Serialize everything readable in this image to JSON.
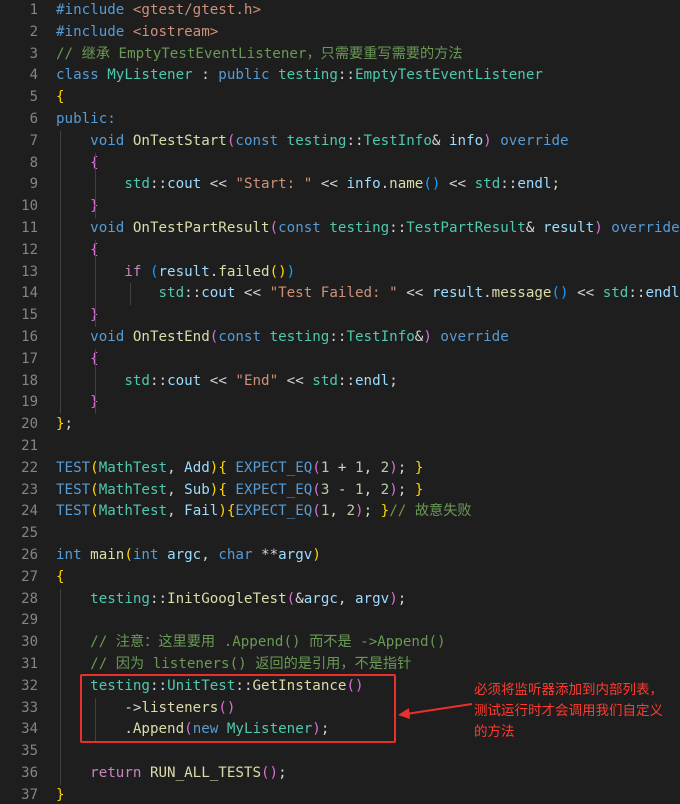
{
  "editor": {
    "theme_colors": {
      "background": "#1e1e1e",
      "line_number": "#858585",
      "keyword": "#569cd6",
      "control": "#c586c0",
      "type": "#4ec9b0",
      "function": "#dcdcaa",
      "string": "#ce9178",
      "comment": "#6a9955",
      "variable": "#9cdcfe",
      "number": "#b5cea8",
      "default": "#d4d4d4",
      "bracket": "#ffd700",
      "bracket2": "#da70d6",
      "bracket3": "#179fff",
      "annotation": "#ff3b30"
    },
    "lines": [
      {
        "n": "1",
        "tokens": [
          [
            "#include ",
            "keyword"
          ],
          [
            "<gtest/gtest.h>",
            "string"
          ]
        ]
      },
      {
        "n": "2",
        "tokens": [
          [
            "#include ",
            "keyword"
          ],
          [
            "<iostream>",
            "string"
          ]
        ]
      },
      {
        "n": "3",
        "tokens": [
          [
            "// 继承 EmptyTestEventListener，只需要重写需要的方法",
            "comment"
          ]
        ]
      },
      {
        "n": "4",
        "tokens": [
          [
            "class ",
            "keyword"
          ],
          [
            "MyListener",
            "type"
          ],
          [
            " : ",
            "default"
          ],
          [
            "public ",
            "keyword"
          ],
          [
            "testing",
            "type"
          ],
          [
            "::",
            "default"
          ],
          [
            "EmptyTestEventListener",
            "type"
          ]
        ]
      },
      {
        "n": "5",
        "tokens": [
          [
            "{",
            "bracket"
          ]
        ]
      },
      {
        "n": "6",
        "tokens": [
          [
            "public:",
            "keyword"
          ]
        ]
      },
      {
        "n": "7",
        "tokens": [
          [
            "    ",
            "default"
          ],
          [
            "void ",
            "keyword"
          ],
          [
            "OnTestStart",
            "function"
          ],
          [
            "(",
            "bracket2"
          ],
          [
            "const ",
            "keyword"
          ],
          [
            "testing",
            "type"
          ],
          [
            "::",
            "default"
          ],
          [
            "TestInfo",
            "type"
          ],
          [
            "& ",
            "default"
          ],
          [
            "info",
            "variable"
          ],
          [
            ")",
            "bracket2"
          ],
          [
            " override",
            "keyword"
          ]
        ]
      },
      {
        "n": "8",
        "tokens": [
          [
            "    ",
            "default"
          ],
          [
            "{",
            "bracket2"
          ]
        ]
      },
      {
        "n": "9",
        "tokens": [
          [
            "        ",
            "default"
          ],
          [
            "std",
            "type"
          ],
          [
            "::",
            "default"
          ],
          [
            "cout",
            "variable"
          ],
          [
            " << ",
            "default"
          ],
          [
            "\"Start: \"",
            "string"
          ],
          [
            " << ",
            "default"
          ],
          [
            "info",
            "variable"
          ],
          [
            ".",
            "default"
          ],
          [
            "name",
            "function"
          ],
          [
            "()",
            "bracket3"
          ],
          [
            " << ",
            "default"
          ],
          [
            "std",
            "type"
          ],
          [
            "::",
            "default"
          ],
          [
            "endl",
            "variable"
          ],
          [
            ";",
            "default"
          ]
        ]
      },
      {
        "n": "10",
        "tokens": [
          [
            "    ",
            "default"
          ],
          [
            "}",
            "bracket2"
          ]
        ]
      },
      {
        "n": "11",
        "tokens": [
          [
            "    ",
            "default"
          ],
          [
            "void ",
            "keyword"
          ],
          [
            "OnTestPartResult",
            "function"
          ],
          [
            "(",
            "bracket2"
          ],
          [
            "const ",
            "keyword"
          ],
          [
            "testing",
            "type"
          ],
          [
            "::",
            "default"
          ],
          [
            "TestPartResult",
            "type"
          ],
          [
            "& ",
            "default"
          ],
          [
            "result",
            "variable"
          ],
          [
            ")",
            "bracket2"
          ],
          [
            " override",
            "keyword"
          ]
        ]
      },
      {
        "n": "12",
        "tokens": [
          [
            "    ",
            "default"
          ],
          [
            "{",
            "bracket2"
          ]
        ]
      },
      {
        "n": "13",
        "tokens": [
          [
            "        ",
            "default"
          ],
          [
            "if ",
            "control"
          ],
          [
            "(",
            "bracket3"
          ],
          [
            "result",
            "variable"
          ],
          [
            ".",
            "default"
          ],
          [
            "failed",
            "function"
          ],
          [
            "()",
            "bracket"
          ],
          [
            ")",
            "bracket3"
          ]
        ]
      },
      {
        "n": "14",
        "tokens": [
          [
            "            ",
            "default"
          ],
          [
            "std",
            "type"
          ],
          [
            "::",
            "default"
          ],
          [
            "cout",
            "variable"
          ],
          [
            " << ",
            "default"
          ],
          [
            "\"Test Failed: \"",
            "string"
          ],
          [
            " << ",
            "default"
          ],
          [
            "result",
            "variable"
          ],
          [
            ".",
            "default"
          ],
          [
            "message",
            "function"
          ],
          [
            "()",
            "bracket3"
          ],
          [
            " << ",
            "default"
          ],
          [
            "std",
            "type"
          ],
          [
            "::",
            "default"
          ],
          [
            "endl",
            "variable"
          ],
          [
            ";",
            "default"
          ]
        ]
      },
      {
        "n": "15",
        "tokens": [
          [
            "    ",
            "default"
          ],
          [
            "}",
            "bracket2"
          ]
        ]
      },
      {
        "n": "16",
        "tokens": [
          [
            "    ",
            "default"
          ],
          [
            "void ",
            "keyword"
          ],
          [
            "OnTestEnd",
            "function"
          ],
          [
            "(",
            "bracket2"
          ],
          [
            "const ",
            "keyword"
          ],
          [
            "testing",
            "type"
          ],
          [
            "::",
            "default"
          ],
          [
            "TestInfo",
            "type"
          ],
          [
            "&",
            "default"
          ],
          [
            ")",
            "bracket2"
          ],
          [
            " override",
            "keyword"
          ]
        ]
      },
      {
        "n": "17",
        "tokens": [
          [
            "    ",
            "default"
          ],
          [
            "{",
            "bracket2"
          ]
        ]
      },
      {
        "n": "18",
        "tokens": [
          [
            "        ",
            "default"
          ],
          [
            "std",
            "type"
          ],
          [
            "::",
            "default"
          ],
          [
            "cout",
            "variable"
          ],
          [
            " << ",
            "default"
          ],
          [
            "\"End\"",
            "string"
          ],
          [
            " << ",
            "default"
          ],
          [
            "std",
            "type"
          ],
          [
            "::",
            "default"
          ],
          [
            "endl",
            "variable"
          ],
          [
            ";",
            "default"
          ]
        ]
      },
      {
        "n": "19",
        "tokens": [
          [
            "    ",
            "default"
          ],
          [
            "}",
            "bracket2"
          ]
        ]
      },
      {
        "n": "20",
        "tokens": [
          [
            "}",
            "bracket"
          ],
          [
            ";",
            "default"
          ]
        ]
      },
      {
        "n": "21",
        "tokens": []
      },
      {
        "n": "22",
        "tokens": [
          [
            "TEST",
            "keyword"
          ],
          [
            "(",
            "bracket"
          ],
          [
            "MathTest",
            "type"
          ],
          [
            ", ",
            "default"
          ],
          [
            "Add",
            "variable"
          ],
          [
            ")",
            "bracket"
          ],
          [
            "{",
            "bracket"
          ],
          [
            " EXPECT_EQ",
            "keyword"
          ],
          [
            "(",
            "bracket2"
          ],
          [
            "1",
            "number"
          ],
          [
            " + ",
            "default"
          ],
          [
            "1",
            "number"
          ],
          [
            ", ",
            "default"
          ],
          [
            "2",
            "number"
          ],
          [
            ")",
            "bracket2"
          ],
          [
            "; ",
            "default"
          ],
          [
            "}",
            "bracket"
          ]
        ]
      },
      {
        "n": "23",
        "tokens": [
          [
            "TEST",
            "keyword"
          ],
          [
            "(",
            "bracket"
          ],
          [
            "MathTest",
            "type"
          ],
          [
            ", ",
            "default"
          ],
          [
            "Sub",
            "variable"
          ],
          [
            ")",
            "bracket"
          ],
          [
            "{",
            "bracket"
          ],
          [
            " EXPECT_EQ",
            "keyword"
          ],
          [
            "(",
            "bracket2"
          ],
          [
            "3",
            "number"
          ],
          [
            " - ",
            "default"
          ],
          [
            "1",
            "number"
          ],
          [
            ", ",
            "default"
          ],
          [
            "2",
            "number"
          ],
          [
            ")",
            "bracket2"
          ],
          [
            "; ",
            "default"
          ],
          [
            "}",
            "bracket"
          ]
        ]
      },
      {
        "n": "24",
        "tokens": [
          [
            "TEST",
            "keyword"
          ],
          [
            "(",
            "bracket"
          ],
          [
            "MathTest",
            "type"
          ],
          [
            ", ",
            "default"
          ],
          [
            "Fail",
            "variable"
          ],
          [
            ")",
            "bracket"
          ],
          [
            "{",
            "bracket"
          ],
          [
            "EXPECT_EQ",
            "keyword"
          ],
          [
            "(",
            "bracket2"
          ],
          [
            "1",
            "number"
          ],
          [
            ", ",
            "default"
          ],
          [
            "2",
            "number"
          ],
          [
            ")",
            "bracket2"
          ],
          [
            "; ",
            "default"
          ],
          [
            "}",
            "bracket"
          ],
          [
            "// 故意失败",
            "comment"
          ]
        ]
      },
      {
        "n": "25",
        "tokens": []
      },
      {
        "n": "26",
        "tokens": [
          [
            "int ",
            "keyword"
          ],
          [
            "main",
            "function"
          ],
          [
            "(",
            "bracket"
          ],
          [
            "int ",
            "keyword"
          ],
          [
            "argc",
            "variable"
          ],
          [
            ", ",
            "default"
          ],
          [
            "char ",
            "keyword"
          ],
          [
            "**",
            "default"
          ],
          [
            "argv",
            "variable"
          ],
          [
            ")",
            "bracket"
          ]
        ]
      },
      {
        "n": "27",
        "tokens": [
          [
            "{",
            "bracket"
          ]
        ]
      },
      {
        "n": "28",
        "tokens": [
          [
            "    ",
            "default"
          ],
          [
            "testing",
            "type"
          ],
          [
            "::",
            "default"
          ],
          [
            "InitGoogleTest",
            "function"
          ],
          [
            "(",
            "bracket2"
          ],
          [
            "&",
            "default"
          ],
          [
            "argc",
            "variable"
          ],
          [
            ", ",
            "default"
          ],
          [
            "argv",
            "variable"
          ],
          [
            ")",
            "bracket2"
          ],
          [
            ";",
            "default"
          ]
        ]
      },
      {
        "n": "29",
        "tokens": []
      },
      {
        "n": "30",
        "tokens": [
          [
            "    ",
            "default"
          ],
          [
            "// 注意：这里要用 .Append() 而不是 ->Append()",
            "comment"
          ]
        ]
      },
      {
        "n": "31",
        "tokens": [
          [
            "    ",
            "default"
          ],
          [
            "// 因为 listeners() 返回的是引用，不是指针",
            "comment"
          ]
        ]
      },
      {
        "n": "32",
        "tokens": [
          [
            "    ",
            "default"
          ],
          [
            "testing",
            "type"
          ],
          [
            "::",
            "default"
          ],
          [
            "UnitTest",
            "type"
          ],
          [
            "::",
            "default"
          ],
          [
            "GetInstance",
            "function"
          ],
          [
            "()",
            "bracket2"
          ]
        ]
      },
      {
        "n": "33",
        "tokens": [
          [
            "        ",
            "default"
          ],
          [
            "->",
            "default"
          ],
          [
            "listeners",
            "function"
          ],
          [
            "()",
            "bracket2"
          ]
        ]
      },
      {
        "n": "34",
        "tokens": [
          [
            "        ",
            "default"
          ],
          [
            ".",
            "default"
          ],
          [
            "Append",
            "function"
          ],
          [
            "(",
            "bracket2"
          ],
          [
            "new ",
            "keyword"
          ],
          [
            "MyListener",
            "type"
          ],
          [
            ")",
            "bracket2"
          ],
          [
            ";",
            "default"
          ]
        ]
      },
      {
        "n": "35",
        "tokens": []
      },
      {
        "n": "36",
        "tokens": [
          [
            "    ",
            "default"
          ],
          [
            "return ",
            "control"
          ],
          [
            "RUN_ALL_TESTS",
            "function"
          ],
          [
            "()",
            "bracket2"
          ],
          [
            ";",
            "default"
          ]
        ]
      },
      {
        "n": "37",
        "tokens": [
          [
            "}",
            "bracket"
          ]
        ]
      }
    ]
  },
  "annotation": {
    "text": "必须将监听器添加到内部列表，测试运行时才会调用我们自定义的方法"
  }
}
